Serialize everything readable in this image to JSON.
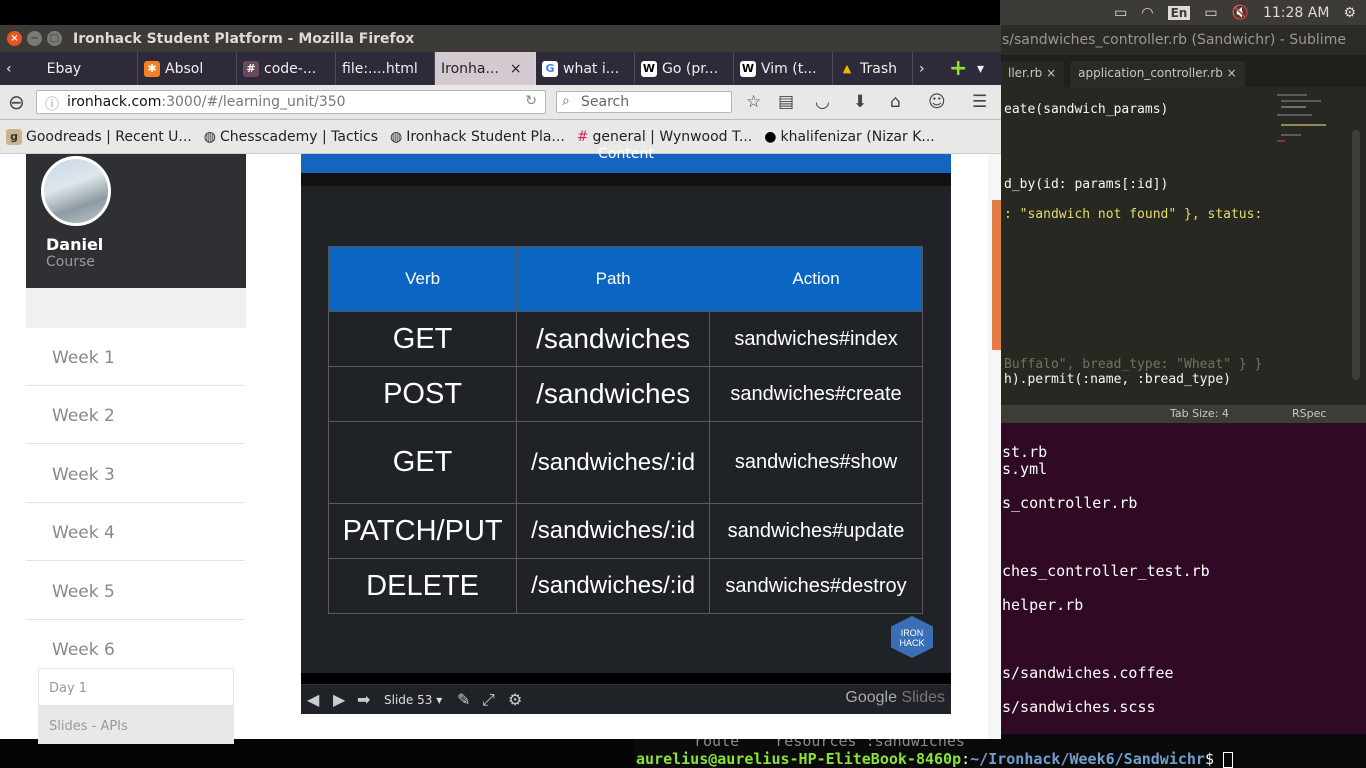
{
  "system_panel": {
    "lang": "En",
    "time": "11:28 AM"
  },
  "sublime": {
    "title": "s/sandwiches_controller.rb (Sandwichr) - Sublime",
    "tabs": [
      "ller.rb",
      "application_controller.rb"
    ],
    "code_lines": [
      "eate(sandwich_params)",
      "d_by(id: params[:id])",
      ": \"sandwich not found\" }, status:",
      "Buffalo\", bread_type: \"Wheat\" } }",
      "h).permit(:name, :bread_type)"
    ],
    "status": {
      "tab_size": "Tab Size: 4",
      "syntax": "RSpec"
    }
  },
  "terminal": {
    "lines": [
      "st.rb",
      "s.yml",
      "s_controller.rb",
      "ches_controller_test.rb",
      "helper.rb",
      "s/sandwiches.coffee",
      "s/sandwiches.scss"
    ],
    "route_line": "route    resources :sandwiches",
    "prompt_user": "aurelius@aurelius-HP-EliteBook-8460p",
    "prompt_path": "~/Ironhack/Week6/Sandwichr",
    "prompt_sign": "$"
  },
  "firefox": {
    "title": "Ironhack Student Platform - Mozilla Firefox",
    "tabs": [
      {
        "label": "Ebay",
        "icon": "back-arrow-icon"
      },
      {
        "label": "Absol",
        "icon": "absol-icon"
      },
      {
        "label": "code-...",
        "icon": "hash-icon"
      },
      {
        "label": "file:....html",
        "icon": "file-icon"
      },
      {
        "label": "Ironha...",
        "icon": "ironhack-icon"
      },
      {
        "label": "what i...",
        "icon": "google-icon"
      },
      {
        "label": "Go (pr...",
        "icon": "wikipedia-icon"
      },
      {
        "label": "Vim (t...",
        "icon": "wikipedia-icon"
      },
      {
        "label": "Trash",
        "icon": "drive-icon"
      }
    ],
    "url_host": "ironhack.com",
    "url_rest": ":3000/#/learning_unit/350",
    "search_placeholder": "Search",
    "bookmarks": [
      "Goodreads | Recent U...",
      "Chesscademy | Tactics",
      "Ironhack Student Pla...",
      "general | Wynwood T...",
      "khalifenizar (Nizar K..."
    ]
  },
  "sidebar": {
    "user_name": "Daniel",
    "user_sub": "Course",
    "weeks": [
      "Week 1",
      "Week 2",
      "Week 3",
      "Week 4",
      "Week 5",
      "Week 6"
    ],
    "sub_items": [
      "Day 1",
      "Slides - APIs"
    ]
  },
  "slide": {
    "top_label": "Content",
    "headers": [
      "Verb",
      "Path",
      "Action"
    ],
    "rows": [
      [
        "GET",
        "/sandwiches",
        "sandwiches#index"
      ],
      [
        "POST",
        "/sandwiches",
        "sandwiches#create"
      ],
      [
        "GET",
        "/sandwiches/:id",
        "sandwiches#show"
      ],
      [
        "PATCH/PUT",
        "/sandwiches/:id",
        "sandwiches#update"
      ],
      [
        "DELETE",
        "/sandwiches/:id",
        "sandwiches#destroy"
      ]
    ],
    "logo_line1": "IRON",
    "logo_line2": "HACK",
    "slide_label": "Slide 53",
    "brand_google": "Google",
    "brand_slides": "Slides"
  },
  "colors": {
    "slide_header": "#0a66c2",
    "slide_bg": "#1f2226",
    "terminal_bg": "#300a24",
    "sidebar_head": "#2f3033"
  }
}
